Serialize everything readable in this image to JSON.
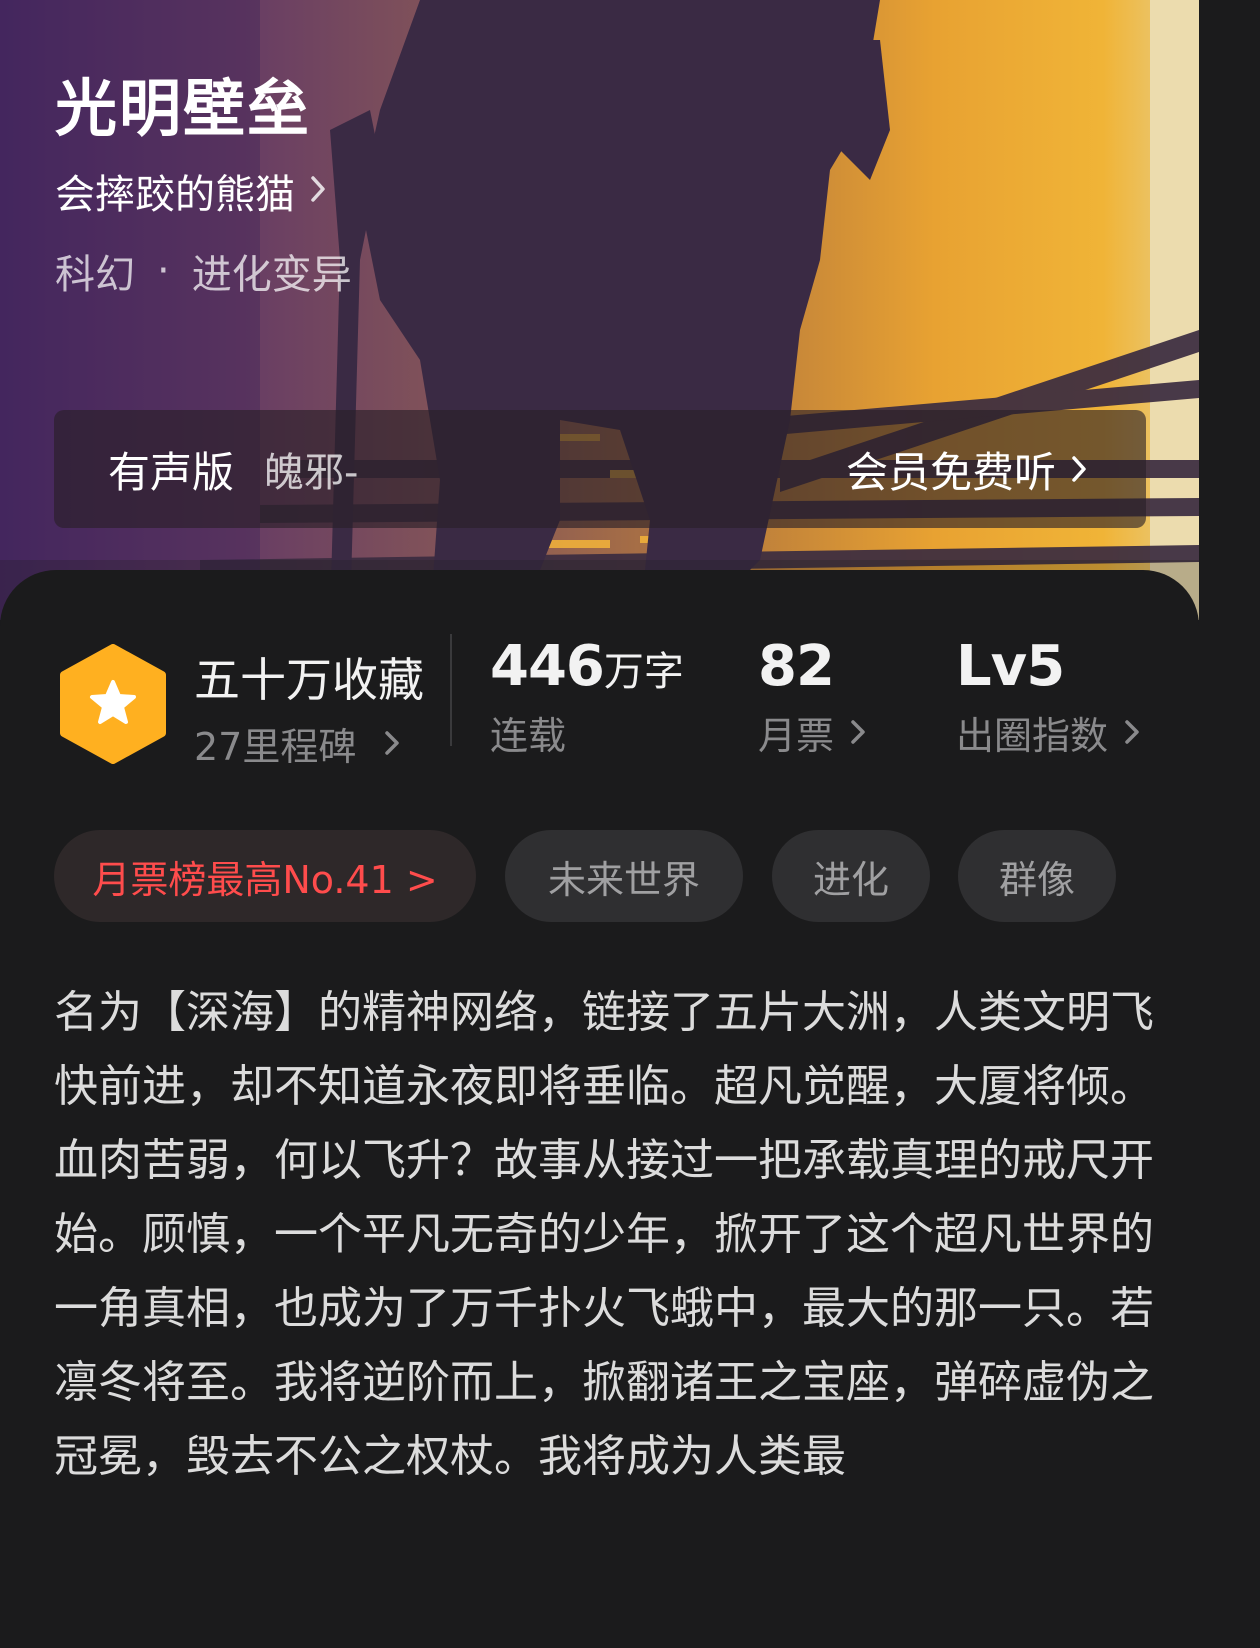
{
  "book": {
    "title": "光明壁垒",
    "author": "会摔跤的熊猫",
    "genre_category": "科幻",
    "genre_separator": "·",
    "genre_sub": "进化变异"
  },
  "audio": {
    "label": "有声版",
    "narrator": "魄邪-",
    "action_label": "会员免费听"
  },
  "stats": {
    "collections": {
      "title": "五十万收藏",
      "subtitle": "27里程碑"
    },
    "word_count": {
      "number": "446",
      "unit": "万字",
      "status": "连载"
    },
    "monthly_votes": {
      "number": "82",
      "label": "月票"
    },
    "influence": {
      "number": "Lv5",
      "label": "出圈指数"
    }
  },
  "tags": [
    {
      "label": "月票榜最高No.41 >"
    },
    {
      "label": "未来世界"
    },
    {
      "label": "进化"
    },
    {
      "label": "群像"
    }
  ],
  "synopsis": "名为【深海】的精神网络，链接了五片大洲，人类文明飞快前进，却不知道永夜即将垂临。超凡觉醒，大厦将倾。血肉苦弱，何以飞升？故事从接过一把承载真理的戒尺开始。顾慎，一个平凡无奇的少年，掀开了这个超凡世界的一角真相，也成为了万千扑火飞蛾中，最大的那一只。若凛冬将至。我将逆阶而上，掀翻诸王之宝座，弹碎虚伪之冠冕，毁去不公之权杖。我将成为人类最",
  "colors": {
    "background": "#1b1b1c",
    "rank_tag_text": "#ff4c4c",
    "badge_fill": "#ffb020",
    "tag_bg": "#2f2f31"
  }
}
